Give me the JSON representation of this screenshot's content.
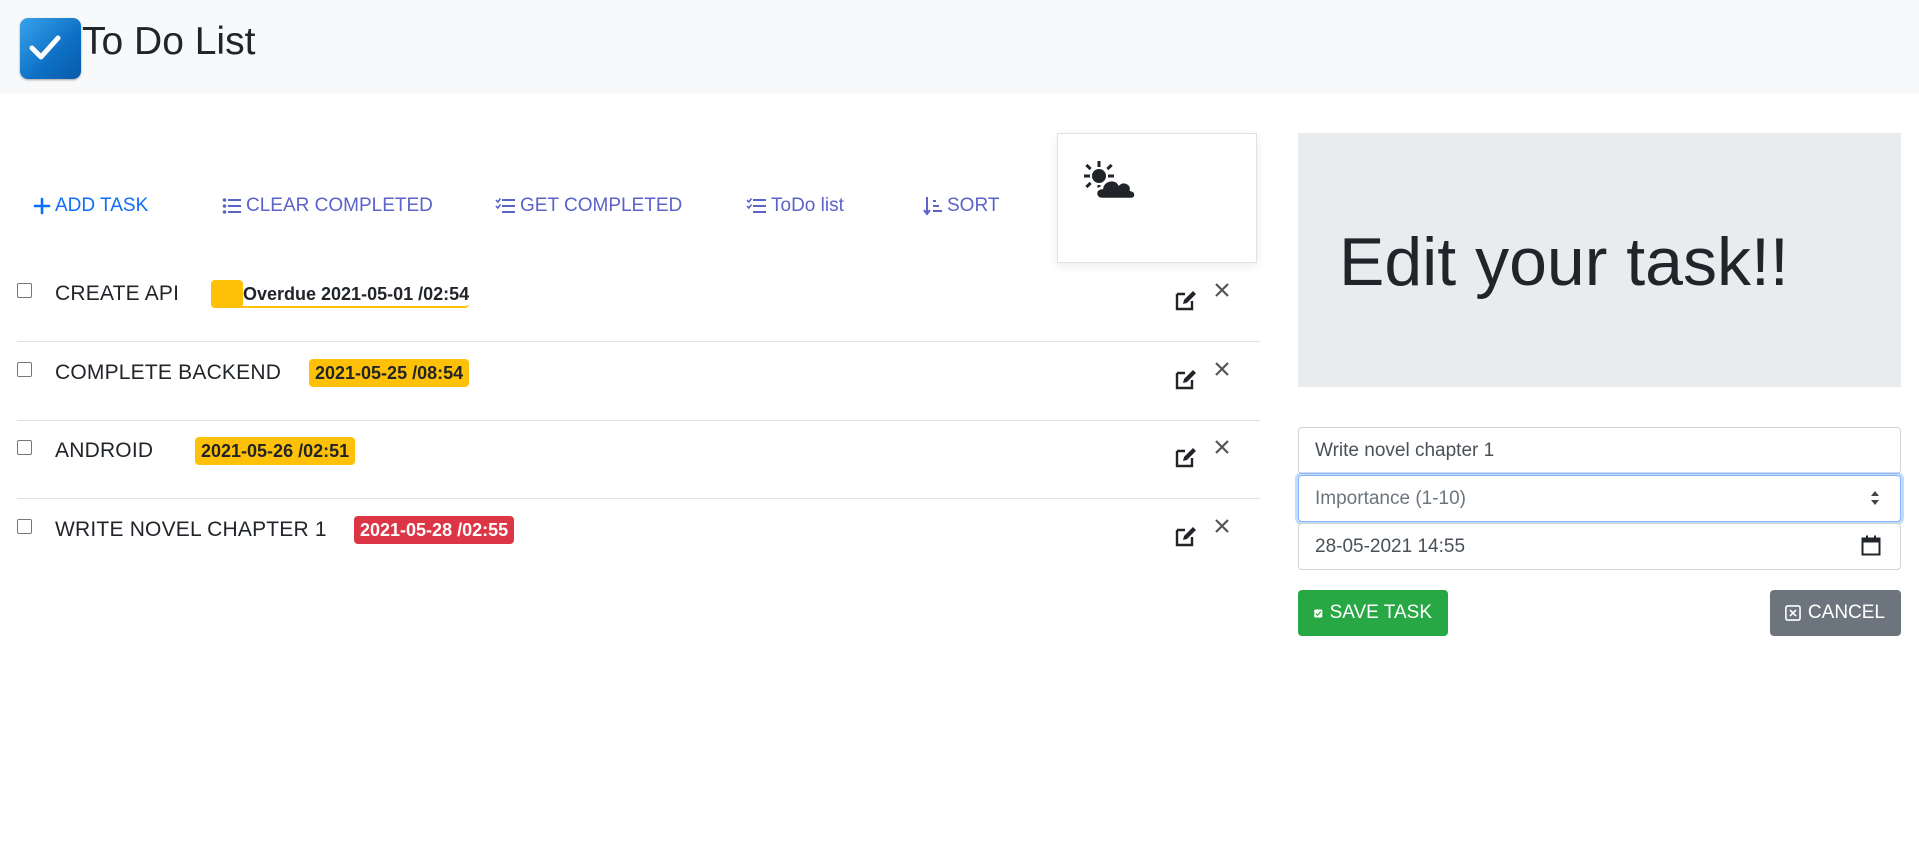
{
  "app": {
    "title": "To Do List"
  },
  "toolbar": {
    "add_task": "ADD TASK",
    "clear_completed": "CLEAR COMPLETED",
    "get_completed": "GET COMPLETED",
    "todo_list": "ToDo list",
    "sort": "SORT"
  },
  "weather": {
    "icon": "partly-cloudy-icon"
  },
  "tasks": [
    {
      "name": "CREATE API",
      "due": "Overdue 2021-05-01 /02:54",
      "status": "overdue"
    },
    {
      "name": "COMPLETE BACKEND",
      "due": "2021-05-25 /08:54",
      "status": "warning"
    },
    {
      "name": "ANDROID",
      "due": "2021-05-26 /02:51",
      "status": "warning"
    },
    {
      "name": "WRITE NOVEL CHAPTER 1",
      "due": "2021-05-28 /02:55",
      "status": "danger"
    }
  ],
  "edit": {
    "heading": "Edit your task!!",
    "task_value": "Write novel chapter 1",
    "importance_placeholder": "Importance (1-10)",
    "importance_value": "",
    "datetime_value": "28-05-2021 14:55",
    "save_label": "SAVE TASK",
    "cancel_label": "CANCEL"
  },
  "colors": {
    "primary": "#0d6efd",
    "link": "#5b63c9",
    "warning": "#ffc107",
    "danger": "#dc3545",
    "success": "#28a745",
    "secondary": "#6c757d",
    "navbar": "#f8f9fa",
    "jumbotron": "#e9ecef"
  }
}
